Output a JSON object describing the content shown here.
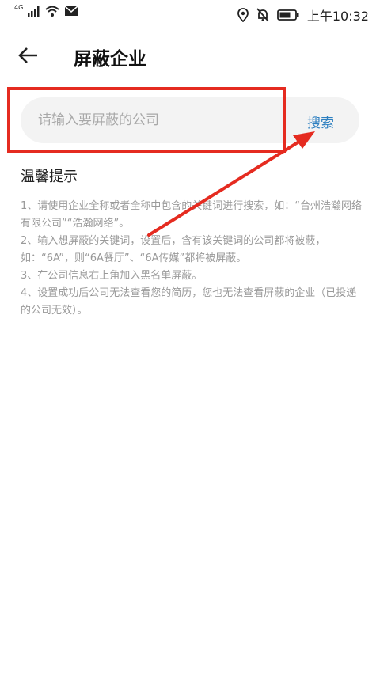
{
  "status_bar": {
    "network": "4G",
    "time": "上午10:32"
  },
  "header": {
    "title": "屏蔽企业"
  },
  "search": {
    "placeholder": "请输入要屏蔽的公司",
    "value": "",
    "button_label": "搜索"
  },
  "tips": {
    "title": "温馨提示",
    "items": [
      "1、请使用企业全称或者全称中包含的关键词进行搜索，如：“台州浩瀚网络有限公司”“浩瀚网络”。",
      "2、输入想屏蔽的关键词，设置后，含有该关键词的公司都将被蔽，如：“6A”，则“6A餐厅”、“6A传媒”都将被屏蔽。",
      "3、在公司信息右上角加入黑名单屏蔽。",
      "4、设置成功后公司无法查看您的简历，您也无法查看屏蔽的企业（已投递的公司无效）。"
    ]
  },
  "annotation_colors": {
    "highlight": "#e52b20",
    "link": "#2d7fc0"
  }
}
